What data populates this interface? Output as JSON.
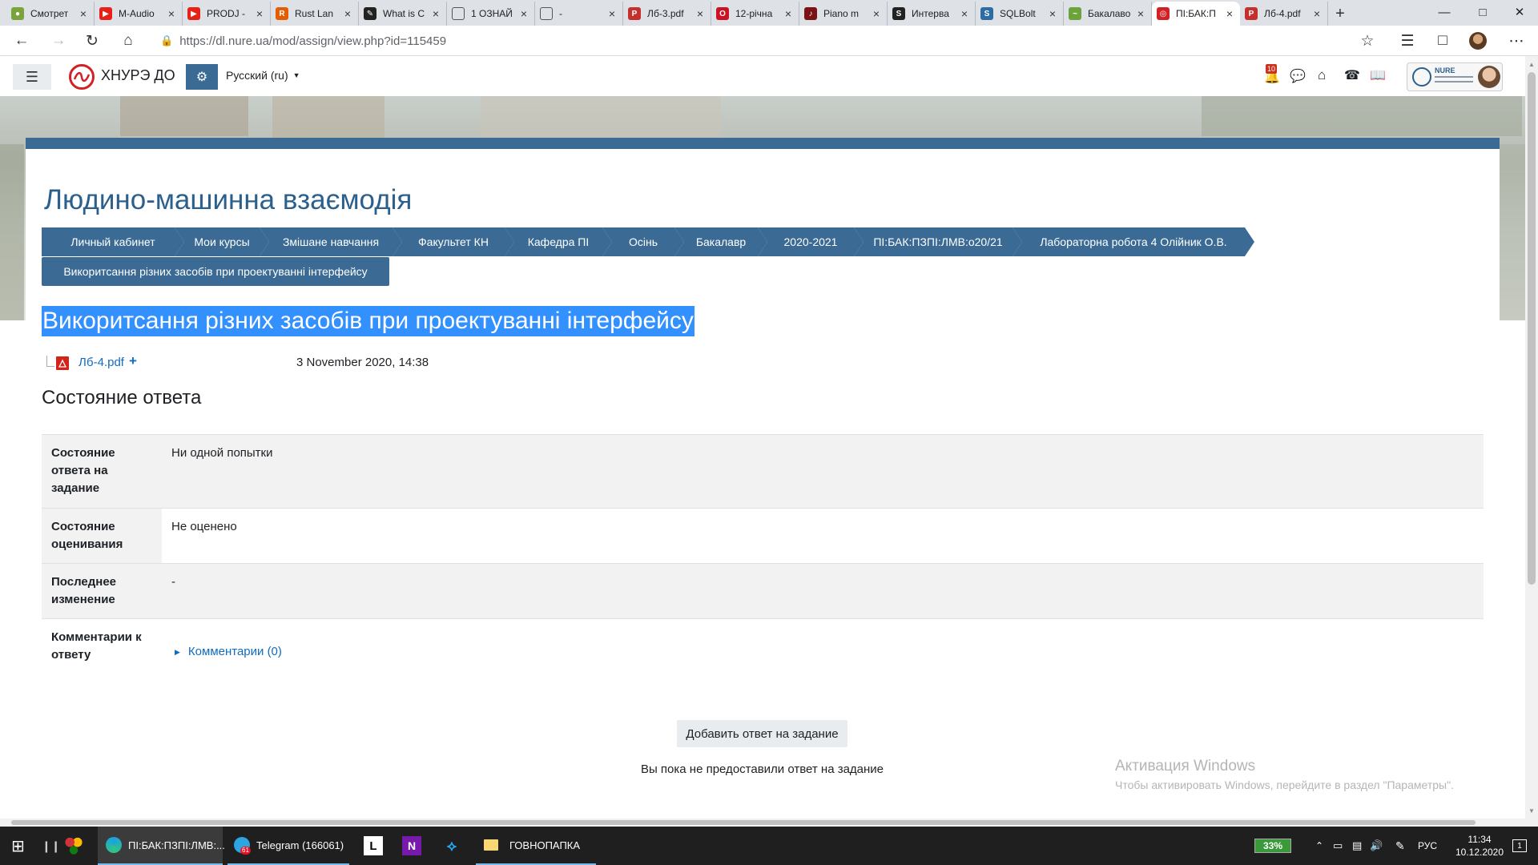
{
  "browser": {
    "tabs": [
      {
        "title": "Смотрет",
        "icon": "globe-icon",
        "color": "#7aa33a",
        "active": false
      },
      {
        "title": "M-Audio",
        "icon": "youtube-icon",
        "color": "#e62117",
        "active": false
      },
      {
        "title": "PRODJ -",
        "icon": "youtube-icon",
        "color": "#e62117",
        "active": false
      },
      {
        "title": "Rust Lan",
        "icon": "rust-icon",
        "color": "#e65c00",
        "active": false
      },
      {
        "title": "What is C",
        "icon": "book-icon",
        "color": "#222222",
        "active": false
      },
      {
        "title": "1 ОЗНАЙ",
        "icon": "page-icon",
        "color": "#888888",
        "active": false
      },
      {
        "title": "-",
        "icon": "page-icon",
        "color": "#888888",
        "active": false
      },
      {
        "title": "Лб-3.pdf",
        "icon": "pdf-icon",
        "color": "#c4302b",
        "active": false
      },
      {
        "title": "12-річна",
        "icon": "opera-icon",
        "color": "#cc1122",
        "active": false
      },
      {
        "title": "Piano m",
        "icon": "piano-icon",
        "color": "#7a1414",
        "active": false
      },
      {
        "title": "Интерва",
        "icon": "s-icon",
        "color": "#222222",
        "active": false
      },
      {
        "title": "SQLBolt",
        "icon": "sqlbolt-icon",
        "color": "#2e6da4",
        "active": false
      },
      {
        "title": "Бакалаво",
        "icon": "leaf-icon",
        "color": "#6ca33a",
        "active": false
      },
      {
        "title": "ПІ:БАК:П",
        "icon": "nure-icon",
        "color": "#d22027",
        "active": true
      },
      {
        "title": "Лб-4.pdf",
        "icon": "pdf-icon",
        "color": "#c4302b",
        "active": false
      }
    ],
    "url": "https://dl.nure.ua/mod/assign/view.php?id=115459"
  },
  "navbar": {
    "site_name": "ХНУРЭ ДО",
    "language": "Русский (ru)",
    "notification_count": "10",
    "logo_text": "NURE"
  },
  "course_title": "Людино-машинна взаємодія",
  "breadcrumbs": [
    "Личный кабинет",
    "Мои курсы",
    "Змішане навчання",
    "Факультет КН",
    "Кафедра ПІ",
    "Осінь",
    "Бакалавр",
    "2020-2021",
    "ПІ:БАК:ПЗПІ:ЛМВ:о20/21",
    "Лабораторна робота 4 Олійник О.В.",
    "Викоритсання різних засобів при проектуванні інтерфейсу"
  ],
  "assignment": {
    "title": "Викоритсання різних засобів при проектуванні інтерфейсу",
    "file_name": "Лб-4.pdf",
    "file_date": "3 November 2020, 14:38"
  },
  "status": {
    "heading": "Состояние ответа",
    "rows": [
      {
        "label": "Состояние ответа на задание",
        "value": "Ни одной попытки"
      },
      {
        "label": "Состояние оценивания",
        "value": "Не оценено"
      },
      {
        "label": "Последнее изменение",
        "value": "-"
      },
      {
        "label": "Комментарии к ответу",
        "value": "Комментарии (0)"
      }
    ]
  },
  "add_button": "Добавить ответ на задание",
  "no_answer_note": "Вы пока не предоставили ответ на задание",
  "watermark": {
    "title": "Активация Windows",
    "subtitle": "Чтобы активировать Windows, перейдите в раздел \"Параметры\"."
  },
  "taskbar": {
    "edge_window": "ПІ:БАК:ПЗПІ:ЛМВ:...",
    "telegram_window": "Telegram (166061)",
    "folder_window": "ГОВНОПАПКА",
    "battery": "33%",
    "lang": "РУС",
    "time": "11:34",
    "date": "10.12.2020",
    "notif_count": "1",
    "telegram_badge": "61"
  },
  "colors": {
    "primary": "#3b6b94",
    "link": "#0f6cbf",
    "title": "#2b5f8c",
    "selection": "#3390ff"
  }
}
